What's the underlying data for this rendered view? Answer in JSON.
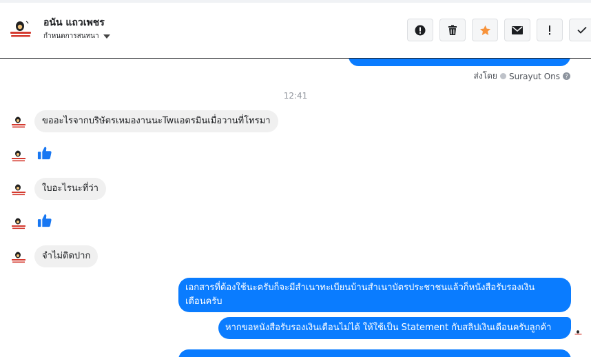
{
  "header": {
    "contact_name": "อนัน แถวเพชร",
    "assign_label": "กำหนดการสนทนา",
    "actions": [
      {
        "name": "mark-spam-icon",
        "label": "!"
      },
      {
        "name": "trash-icon",
        "label": ""
      },
      {
        "name": "star-icon",
        "label": ""
      },
      {
        "name": "mail-icon",
        "label": ""
      },
      {
        "name": "follow-up-icon",
        "label": "!"
      },
      {
        "name": "done-check-icon",
        "label": ""
      }
    ]
  },
  "chat": {
    "sent_by_prefix": "ส่งโดย",
    "sent_by_name": "Surayut Ons",
    "time_divider": "12:41",
    "messages": [
      {
        "side": "in",
        "text": "ขออะไรจากบริษัตรเหมองานนะTwแอตรมินเมื่อวานที่โทรมา"
      },
      {
        "side": "in",
        "type": "like"
      },
      {
        "side": "in",
        "text": "ใบอะไรนะที่ว่า"
      },
      {
        "side": "in",
        "type": "like"
      },
      {
        "side": "in",
        "text": "จำไม่ติดปาก"
      },
      {
        "side": "out",
        "text_line1": "เอกสารที่ต้องใช้นะครับก็จะมีสำเนาทะเบียนบ้านสำเนาบัตรประชาชนแล้วก็หนังสือรับรองเงิน",
        "text_line2": "เดือนครับ"
      },
      {
        "side": "out",
        "text": "หากขอหนังสือรับรองเงินเดือนไม่ได้ ให้ใช้เป็น Statement กับสลิปเงินเดือนครับลูกค้า"
      }
    ]
  },
  "colors": {
    "outgoing_bubble": "#0a7cff",
    "incoming_bubble": "#f0f0f0",
    "like_blue": "#1877f2",
    "star_orange": "#f7923a"
  }
}
